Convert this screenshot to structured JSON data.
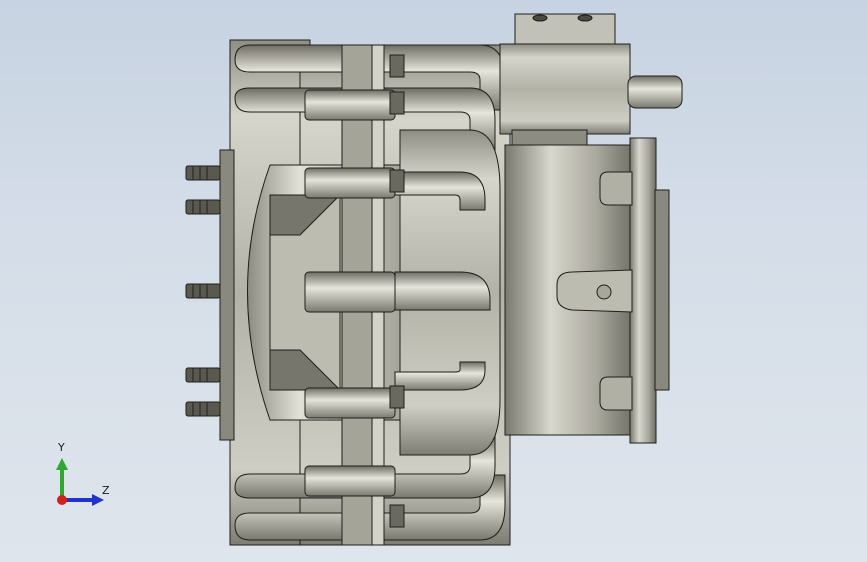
{
  "viewport": {
    "background_top": "#c7d3e2",
    "background_bottom": "#dfe5ec"
  },
  "model": {
    "icon": "motor-assembly-icon",
    "metal_light": "#c9c8be",
    "metal_mid": "#9d9c90",
    "metal_dark": "#5f5e55",
    "edge_color": "#1e1e1a"
  },
  "triad": {
    "x_label": "Z",
    "y_label": "Y",
    "y_color": "#2fa82f",
    "z_color": "#2233cc",
    "origin_color": "#d02020"
  }
}
